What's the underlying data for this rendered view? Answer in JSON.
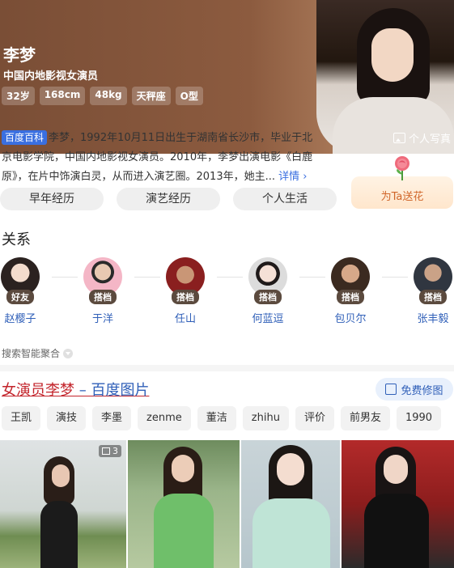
{
  "profile": {
    "name": "李梦",
    "title": "中国内地影视女演员",
    "tags": [
      "32岁",
      "168cm",
      "48kg",
      "天秤座",
      "O型"
    ],
    "photo_button": "个人写真"
  },
  "intro": {
    "badge": "百度百科",
    "text": "李梦，1992年10月11日出生于湖南省长沙市，毕业于北京电影学院，中国内地影视女演员。2010年，李梦出演电影《白鹿原》，在片中饰演白灵，从而进入演艺圈。2013年，她主...",
    "more": "详情 ›"
  },
  "pills": [
    "早年经历",
    "演艺经历",
    "个人生活"
  ],
  "flower_button": "为Ta送花",
  "relations": {
    "title": "关系",
    "items": [
      {
        "badge": "好友",
        "name": "赵樱子"
      },
      {
        "badge": "搭档",
        "name": "于洋"
      },
      {
        "badge": "搭档",
        "name": "任山"
      },
      {
        "badge": "搭档",
        "name": "何蓝逗"
      },
      {
        "badge": "搭档",
        "name": "包贝尔"
      },
      {
        "badge": "搭档",
        "name": "张丰毅"
      }
    ]
  },
  "aggregation": "搜索智能聚合",
  "images": {
    "title_red": "女演员李梦",
    "title_blue": " – 百度图片",
    "free_button": "免费修图",
    "chips": [
      "王凯",
      "演技",
      "李墨",
      "zenme",
      "董洁",
      "zhihu",
      "评价",
      "前男友",
      "1990"
    ],
    "first_count": "3"
  },
  "colors": {
    "accent_blue": "#2f5fb8",
    "title_red": "#c3242b",
    "badge_brown": "#5b4a3e",
    "hero_brown": "#8c5b3f"
  }
}
